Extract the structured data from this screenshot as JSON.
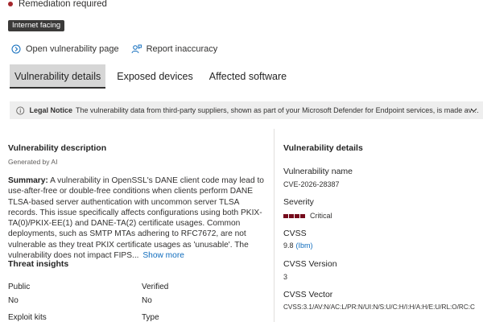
{
  "status": {
    "text": "Remediation required",
    "color": "#a4262c"
  },
  "tag": "Internet facing",
  "actions": [
    {
      "label": "Open vulnerability page",
      "icon": "external-link-icon"
    },
    {
      "label": "Report inaccuracy",
      "icon": "person-feedback-icon"
    }
  ],
  "tabs": [
    {
      "label": "Vulnerability details",
      "active": true
    },
    {
      "label": "Exposed devices",
      "active": false
    },
    {
      "label": "Affected software",
      "active": false
    }
  ],
  "notice": {
    "icon": "info-icon",
    "title": "Legal Notice",
    "text": "The vulnerability data from third-party suppliers, shown as part of your Microsoft Defender for Endpoint services, is made available t..."
  },
  "description": {
    "title": "Vulnerability description",
    "generated": "Generated by AI",
    "summary_label": "Summary:",
    "summary_text": "A vulnerability in OpenSSL's DANE client code may lead to use-after-free or double-free conditions when clients perform DANE TLSA-based server authentication with uncommon server TLSA records. This issue specifically affects configurations using both PKIX-TA(0)/PKIX-EE(1) and DANE-TA(2) certificate usages. Common deployments, such as SMTP MTAs adhering to RFC7672, are not vulnerable as they treat PKIX certificate usages as 'unusable'. The vulnerability does not impact FIPS...",
    "show_more": "Show more"
  },
  "threat_insights": {
    "title": "Threat insights",
    "public_label": "Public",
    "public_value": "No",
    "verified_label": "Verified",
    "verified_value": "No",
    "exploit_label": "Exploit kits",
    "type_label": "Type"
  },
  "details": {
    "title": "Vulnerability details",
    "name_label": "Vulnerability name",
    "name_value": "CVE-2026-28387",
    "severity_label": "Severity",
    "severity_value": "Critical",
    "severity_color": "#750b1c",
    "cvss_label": "CVSS",
    "cvss_value": "9.8",
    "cvss_source": "(Ibm)",
    "cvss_version_label": "CVSS Version",
    "cvss_version_value": "3",
    "cvss_vector_label": "CVSS Vector",
    "cvss_vector_value": "CVSS:3.1/AV:N/AC:L/PR:N/UI:N/S:U/C:H/I:H/A:H/E:U/RL:O/RC:C"
  }
}
